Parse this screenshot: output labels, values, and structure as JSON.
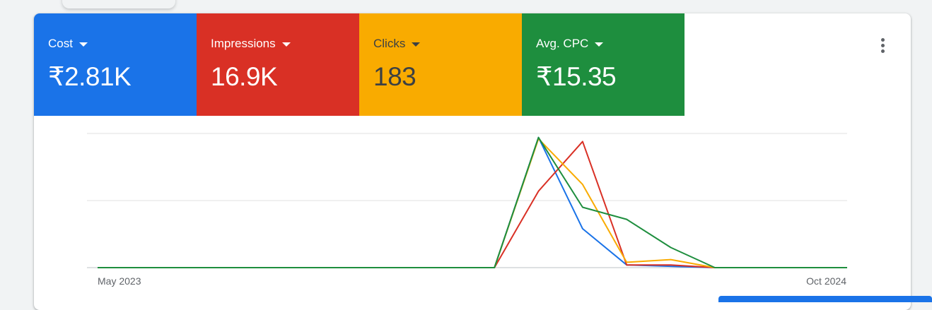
{
  "metrics": [
    {
      "label": "Cost",
      "value": "₹2.81K",
      "bg": "#1a73e8",
      "fg": "#ffffff"
    },
    {
      "label": "Impressions",
      "value": "16.9K",
      "bg": "#d93025",
      "fg": "#ffffff"
    },
    {
      "label": "Clicks",
      "value": "183",
      "bg": "#f9ab00",
      "fg": "#3c4043"
    },
    {
      "label": "Avg. CPC",
      "value": "₹15.35",
      "bg": "#1e8e3e",
      "fg": "#ffffff"
    }
  ],
  "menu_icon": "more-vert-icon",
  "chart_data": {
    "type": "line",
    "x_start_label": "May 2023",
    "x_end_label": "Oct 2024",
    "gridlines": 3,
    "ylim": [
      0,
      100
    ],
    "series": [
      {
        "metric": "Cost",
        "color": "#1a73e8",
        "values": [
          0,
          0,
          0,
          0,
          0,
          0,
          0,
          0,
          0,
          0,
          97,
          29,
          2,
          1,
          0,
          0,
          0,
          0
        ]
      },
      {
        "metric": "Impressions",
        "color": "#d93025",
        "values": [
          0,
          0,
          0,
          0,
          0,
          0,
          0,
          0,
          0,
          0,
          57,
          94,
          2,
          2,
          0,
          0,
          0,
          0
        ]
      },
      {
        "metric": "Clicks",
        "color": "#f9ab00",
        "values": [
          0,
          0,
          0,
          0,
          0,
          0,
          0,
          0,
          0,
          0,
          96,
          62,
          4,
          6,
          0,
          0,
          0,
          0
        ]
      },
      {
        "metric": "Avg. CPC",
        "color": "#1e8e3e",
        "values": [
          0,
          0,
          0,
          0,
          0,
          0,
          0,
          0,
          0,
          0,
          97,
          45,
          36,
          15,
          0,
          0,
          0,
          0
        ]
      }
    ]
  }
}
